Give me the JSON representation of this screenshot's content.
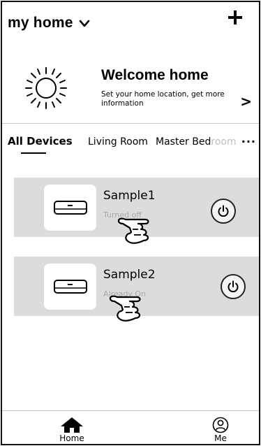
{
  "header": {
    "title": "my home",
    "add_icon": "plus-icon",
    "dropdown_icon": "chevron-down-icon"
  },
  "welcome": {
    "title": "Welcome home",
    "subtitle": "Set your home location, get more information",
    "next_glyph": ">",
    "icon": "sun-icon"
  },
  "tabs": [
    {
      "label": "All Devices",
      "active": true
    },
    {
      "label": "Living Room",
      "active": false
    },
    {
      "label_visible": "Master Bed",
      "label_faded": "room",
      "active": false
    }
  ],
  "more_glyph": "···",
  "devices": [
    {
      "name": "Sample1",
      "status": "Turned off",
      "icon": "air-conditioner-icon",
      "power_icon": "power-icon"
    },
    {
      "name": "Sample2",
      "status": "Already On",
      "icon": "air-conditioner-icon",
      "power_icon": "power-icon"
    }
  ],
  "bottom_nav": [
    {
      "label": "Home",
      "icon": "home-icon"
    },
    {
      "label": "Me",
      "icon": "user-icon"
    }
  ]
}
